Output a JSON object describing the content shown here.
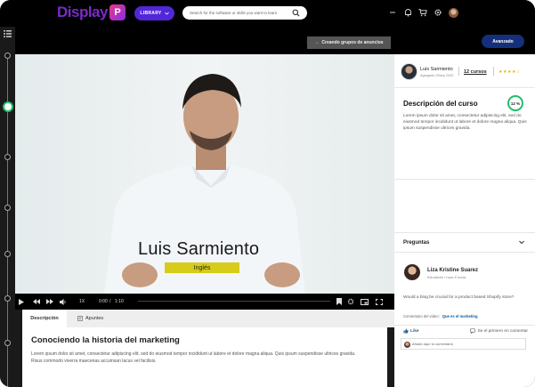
{
  "header": {
    "logo_text": "Display",
    "logo_mark": "P",
    "library_label": "LIBRARY",
    "search_placeholder": "Search for the software or skills you want to learn",
    "icons": [
      "minus-icon",
      "bell-icon",
      "cart-icon",
      "gear-icon",
      "avatar"
    ]
  },
  "subheader": {
    "lesson_button_label": "Creando grupos de anuncios",
    "level_button_label": "Avanzado"
  },
  "video": {
    "presenter_name": "Luis Sarmiento",
    "language_tag": "Inglés",
    "time_current": "0:00",
    "time_total": "1:10",
    "speed_label": "1X"
  },
  "tabs": [
    {
      "label": "Descripción",
      "active": true
    },
    {
      "label": "Apuntes",
      "active": false
    }
  ],
  "lesson": {
    "title": "Conociendo la historia del marketing",
    "body": "Lorem ipsum dolor sit amet, consectetur adipiscing elit, sed do eiusmod tempor incididunt ut labore et dolore magna aliqua. Quis ipsum suspendisse ultrices gravida. Risus commodo viverra maecenas accumsan lacus vel facilisis."
  },
  "instructor": {
    "name": "Luis Sarmiento",
    "date": "Agregado 20sep 2020",
    "courses_label": "12 cursos",
    "rating": "★★★★☆"
  },
  "course": {
    "description_title": "Descripción del curso",
    "progress_label": "12 %",
    "progress_value": 0.12,
    "description_text": "Lorem ipsum dolor sit amet, consectetur adipiscing elit, sed do eiusmod tempor incididunt ut labore et dolore magna aliqua. Quis ipsum suspendisse ultrices gravida."
  },
  "questions": {
    "title": "Preguntas",
    "author": "Liza Kristine Suarez",
    "time": "Estudiante • hace 8 horas",
    "text": "Would a blog be crucial for a product based Shopify store?",
    "context_label": "Comentario del video:",
    "context_link": "Que es el marketing",
    "like_label": "Like",
    "first_comment_label": "Se el primero en comentar",
    "comment_placeholder": "Añade aquí tu comentario"
  },
  "colors": {
    "accent_purple": "#5227d8",
    "level_blue": "#15307a",
    "progress_green": "#1fbf6b",
    "tag_yellow": "#d7cc19"
  }
}
